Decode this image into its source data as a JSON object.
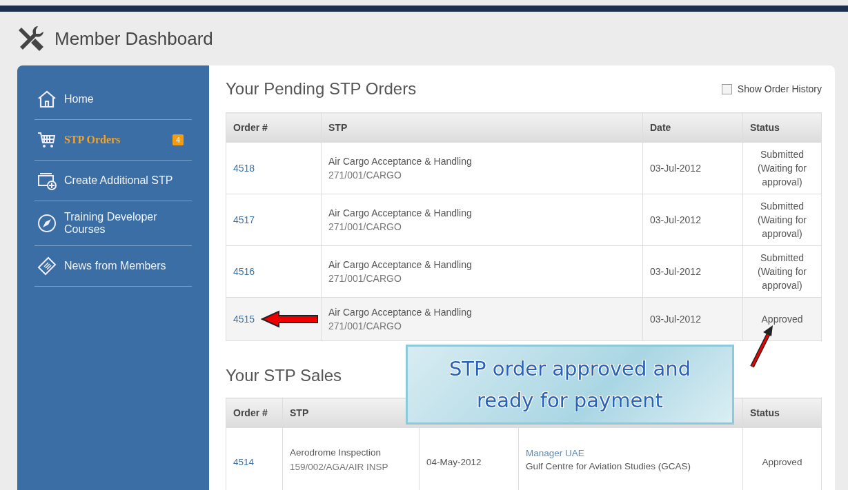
{
  "header": {
    "title": "Member Dashboard"
  },
  "sidebar": {
    "items": [
      {
        "label": "Home",
        "selected": false
      },
      {
        "label": "STP Orders",
        "selected": true,
        "badge": "4"
      },
      {
        "label": "Create Additional STP",
        "selected": false
      },
      {
        "label": "Training Developer Courses",
        "selected": false
      },
      {
        "label": "News from Members",
        "selected": false
      }
    ]
  },
  "pending": {
    "title": "Your Pending STP Orders",
    "history_toggle": {
      "label": "Show Order History",
      "checked": false
    },
    "columns": [
      "Order #",
      "STP",
      "Date",
      "Status"
    ],
    "rows": [
      {
        "order": "4518",
        "stp": "Air Cargo Acceptance & Handling",
        "code": "271/001/CARGO",
        "date": "03-Jul-2012",
        "status": "Submitted (Waiting for approval)",
        "highlighted": false
      },
      {
        "order": "4517",
        "stp": "Air Cargo Acceptance & Handling",
        "code": "271/001/CARGO",
        "date": "03-Jul-2012",
        "status": "Submitted (Waiting for approval)",
        "highlighted": false
      },
      {
        "order": "4516",
        "stp": "Air Cargo Acceptance & Handling",
        "code": "271/001/CARGO",
        "date": "03-Jul-2012",
        "status": "Submitted (Waiting for approval)",
        "highlighted": false
      },
      {
        "order": "4515",
        "stp": "Air Cargo Acceptance & Handling",
        "code": "271/001/CARGO",
        "date": "03-Jul-2012",
        "status": "Approved",
        "highlighted": true
      }
    ]
  },
  "sales": {
    "title": "Your STP Sales",
    "columns": [
      "Order #",
      "STP",
      "",
      "",
      "Status"
    ],
    "rows": [
      {
        "order": "4514",
        "stp": "Aerodrome Inspection",
        "code": "159/002/AGA/AIR INSP",
        "date": "04-May-2012",
        "buyer_role": "Manager UAE",
        "buyer_org": "Gulf Centre for Aviation Studies (GCAS)",
        "status": "Approved"
      }
    ]
  },
  "callout": {
    "text": "STP order approved and ready for payment"
  }
}
